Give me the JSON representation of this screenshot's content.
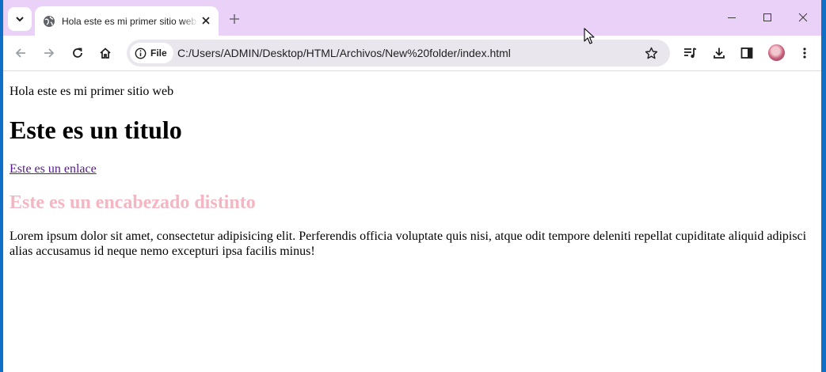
{
  "browser": {
    "tab": {
      "title": "Hola este es mi primer sitio web"
    },
    "toolbar": {
      "chip_label": "File",
      "url": "C:/Users/ADMIN/Desktop/HTML/Archivos/New%20folder/index.html"
    },
    "icons": [
      "tab-search-icon",
      "globe-icon",
      "close-icon",
      "plus-icon",
      "minimize-icon",
      "maximize-icon",
      "close-window-icon",
      "back-icon",
      "forward-icon",
      "reload-icon",
      "home-icon",
      "info-icon",
      "star-icon",
      "media-control-icon",
      "download-icon",
      "side-panel-icon",
      "avatar",
      "more-icon"
    ],
    "colors": {
      "tabstrip": "#ead1f7",
      "omnibox": "#e9e6ee",
      "heading_accent": "#f4b6c2",
      "visited_link": "#551a8b"
    }
  },
  "page": {
    "intro": "Hola este es mi primer sitio web",
    "title": "Este es un titulo",
    "link": "Este es un enlace",
    "subheading": "Este es un encabezado distinto",
    "paragraph": "Lorem ipsum dolor sit amet, consectetur adipisicing elit. Perferendis officia voluptate quis nisi, atque odit tempore deleniti repellat cupiditate aliquid adipisci alias accusamus id neque nemo excepturi ipsa facilis minus!"
  }
}
